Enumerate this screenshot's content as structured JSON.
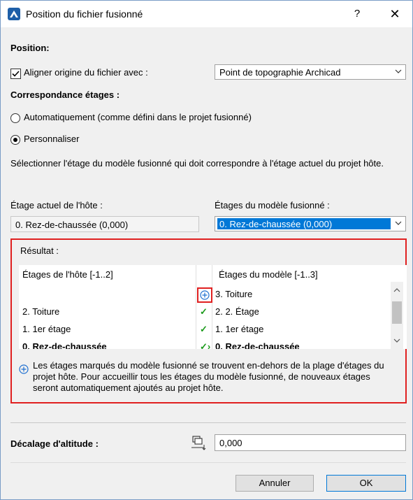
{
  "window": {
    "title": "Position du fichier fusionné",
    "help_label": "?",
    "close_label": "✕"
  },
  "position": {
    "heading": "Position:",
    "align_checkbox_label": "Aligner origine du fichier avec :",
    "align_checked": true,
    "align_combo_value": "Point de topographie Archicad"
  },
  "correspondance": {
    "heading": "Correspondance étages :",
    "radio_auto_label": "Automatiquement (comme défini dans le projet fusionné)",
    "radio_custom_label": "Personnaliser",
    "selected": "custom",
    "description": "Sélectionner l'étage du modèle fusionné qui doit correspondre à l'étage actuel du projet hôte.",
    "host_label": "Étage actuel de l'hôte :",
    "host_value": "0. Rez-de-chaussée (0,000)",
    "model_label": "Étages du modèle fusionné :",
    "model_value": "0. Rez-de-chaussée (0,000)"
  },
  "result": {
    "heading": "Résultat :",
    "col_host": "Étages de l'hôte [-1..2]",
    "col_model": "Étages du modèle [-1..3]",
    "rows": [
      {
        "host": "",
        "status": "plus",
        "model": "3. Toiture",
        "bold": false
      },
      {
        "host": "2. Toiture",
        "status": "check",
        "model": "2. 2. Étage",
        "bold": false
      },
      {
        "host": "1. 1er étage",
        "status": "check",
        "model": "1. 1er étage",
        "bold": false
      },
      {
        "host": "0. Rez-de-chaussée",
        "status": "check-arrow",
        "model": "0. Rez-de-chaussée",
        "bold": true
      }
    ],
    "note": "Les étages marqués du modèle fusionné se trouvent en-dehors de la plage d'étages du projet hôte. Pour accueillir tous les étages du modèle fusionné, de nouveaux étages seront automatiquement ajoutés au projet hôte."
  },
  "offset": {
    "label": "Décalage d'altitude :",
    "value": "0,000"
  },
  "buttons": {
    "cancel": "Annuler",
    "ok": "OK"
  },
  "colors": {
    "accent": "#0078d7",
    "highlight_border": "#e02020",
    "check": "#1a9a1a"
  }
}
